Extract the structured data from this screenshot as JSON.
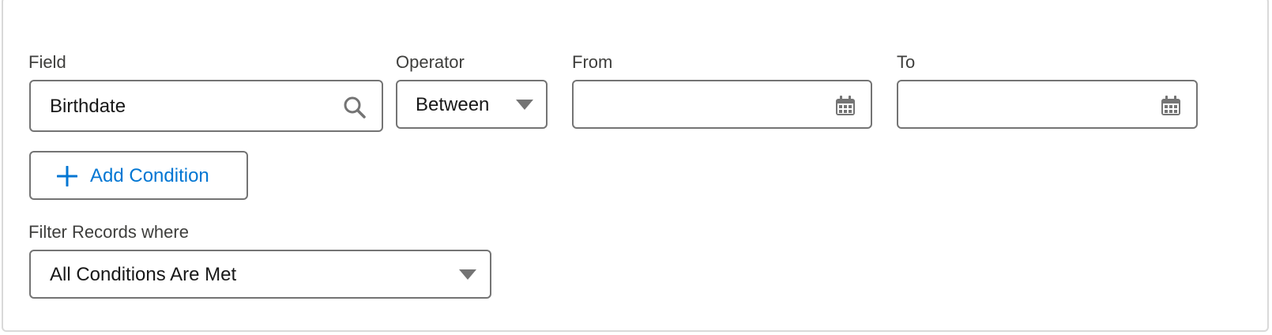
{
  "filter": {
    "field_label": "Field",
    "field_value": "Birthdate",
    "operator_label": "Operator",
    "operator_value": "Between",
    "from_label": "From",
    "from_value": "",
    "to_label": "To",
    "to_value": "",
    "add_condition_label": "Add Condition",
    "logic_label": "Filter Records where",
    "logic_value": "All Conditions Are Met"
  },
  "icons": {
    "field_icon": "search-icon",
    "operator_icon": "chevron-down-icon",
    "date_icon": "calendar-icon",
    "add_icon": "plus-icon",
    "logic_icon": "chevron-down-icon"
  },
  "colors": {
    "accent": "#0176d3",
    "border": "#747474",
    "panel_border": "#d9d9d9",
    "text": "#181818",
    "label_text": "#3e3e3c",
    "icon": "#747474"
  }
}
